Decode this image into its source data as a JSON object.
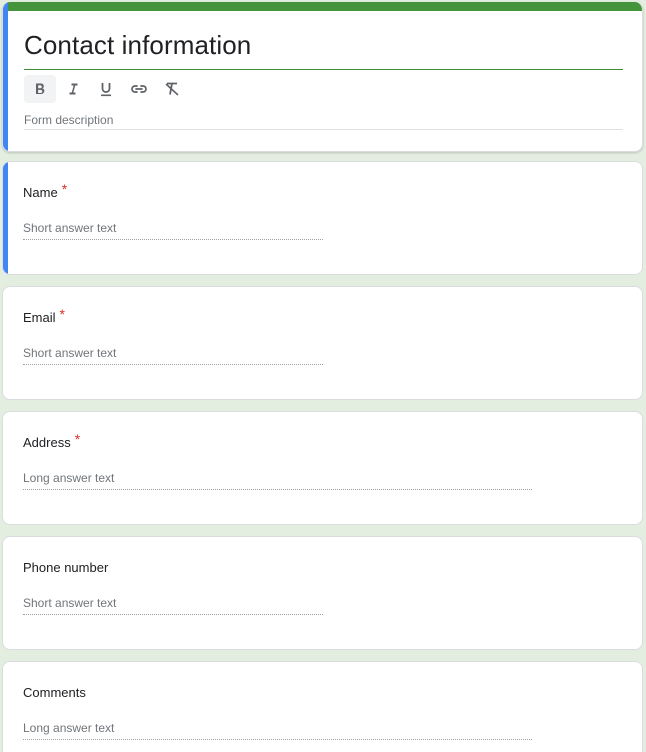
{
  "form": {
    "title": "Contact information",
    "description_placeholder": "Form description",
    "toolbar": {
      "bold": "bold-icon",
      "italic": "italic-icon",
      "underline": "underline-icon",
      "link": "link-icon",
      "clear_format": "clear-format-icon"
    },
    "colors": {
      "theme": "#43943b",
      "accent": "#4285f4",
      "required": "#d93025",
      "background": "#e4eee0"
    }
  },
  "questions": [
    {
      "label": "Name",
      "required": "*",
      "answer_type": "Short answer text"
    },
    {
      "label": "Email",
      "required": "*",
      "answer_type": "Short answer text"
    },
    {
      "label": "Address",
      "required": "*",
      "answer_type": "Long answer text"
    },
    {
      "label": "Phone number",
      "required": "",
      "answer_type": "Short answer text"
    },
    {
      "label": "Comments",
      "required": "",
      "answer_type": "Long answer text"
    }
  ]
}
